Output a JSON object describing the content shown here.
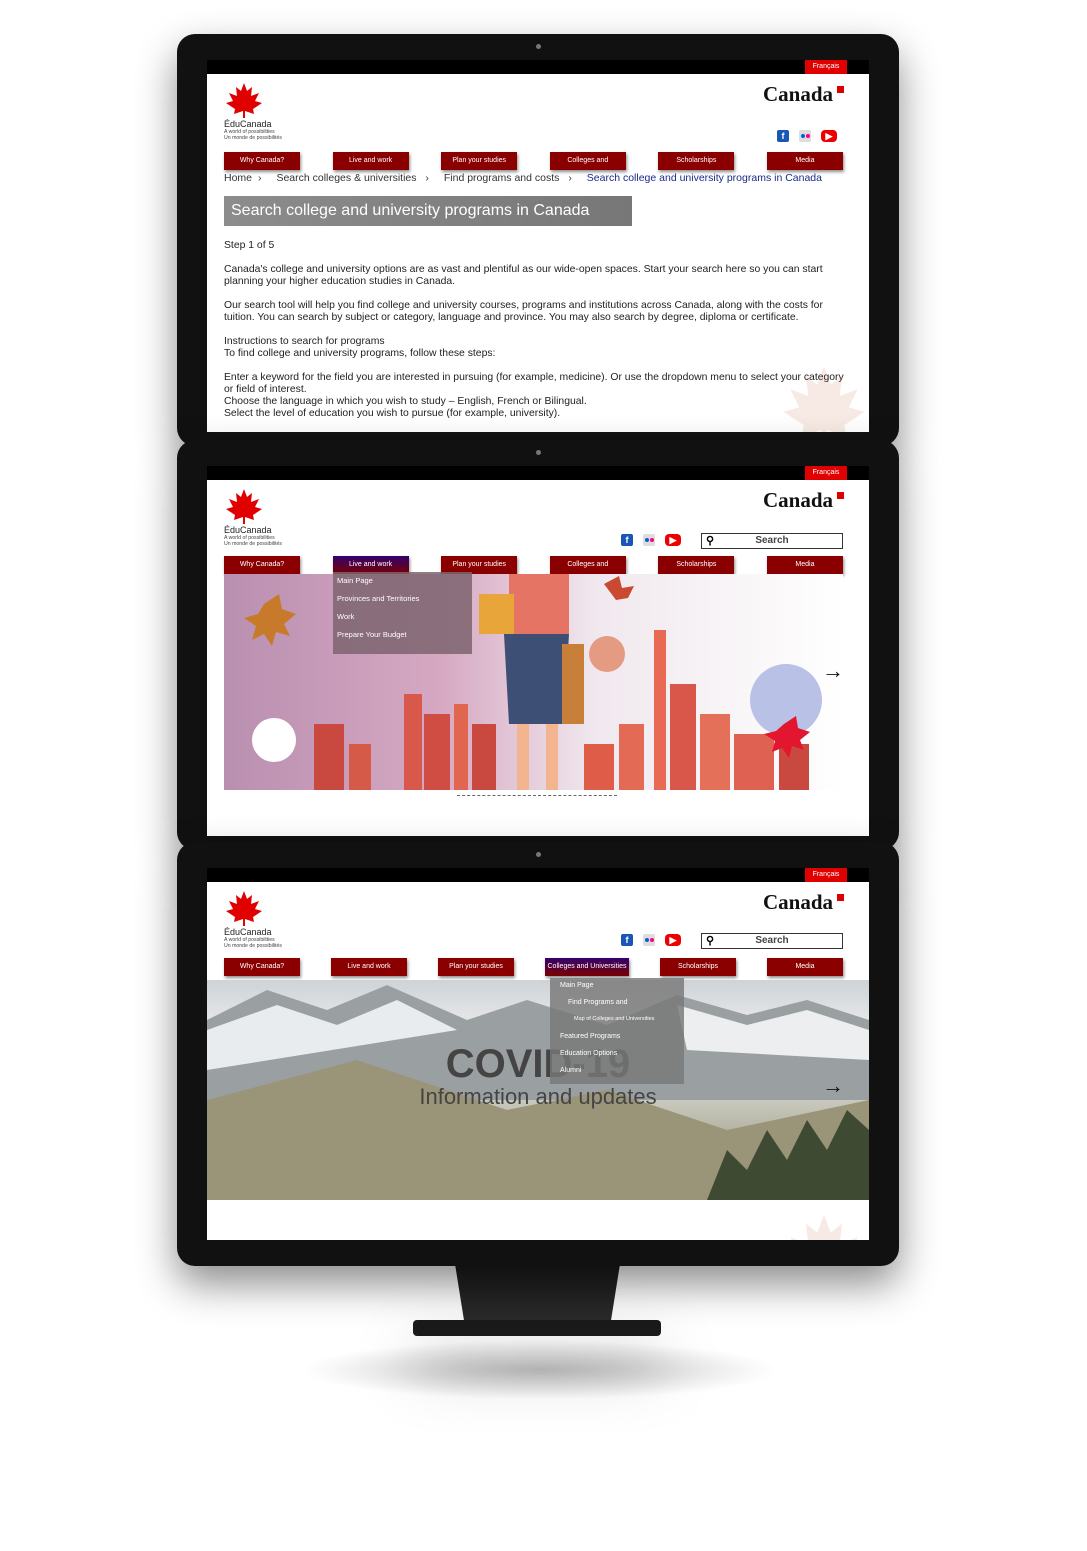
{
  "site": {
    "francais": "Français",
    "logo_name": "ÉduCanada",
    "logo_tag_en": "A world of possibilities",
    "logo_tag_fr": "Un monde de possibilités",
    "wordmark": "Canada",
    "search_label": "Search",
    "nav": [
      "Why Canada?",
      "Live and work",
      "Plan your studies",
      "Colleges and Universities",
      "Scholarships",
      "Media"
    ],
    "colors": {
      "nav": "#8a0000",
      "topbar": "#000000",
      "francais": "#e00000",
      "crumb_current": "#1a2a8a"
    }
  },
  "screen1": {
    "breadcrumbs": [
      "Home",
      "Search colleges & universities",
      "Find programs and costs",
      "Search college and university programs in Canada"
    ],
    "page_title": "Search college and university programs in Canada",
    "step": "Step 1 of 5",
    "para1": "Canada's college and university options are as vast and plentiful as our wide-open spaces. Start your search here so you can start planning your higher education studies in Canada.",
    "para2": "Our search tool will help you find college and university courses, programs and institutions across Canada, along with the costs for tuition. You can search by subject or category, language and province. You may also search by degree, diploma or certificate.",
    "instr_heading": "Instructions to search for programs",
    "instr_intro": "To find college and university programs, follow these steps:",
    "step_a": "Enter a keyword for the field you are interested in pursuing (for example, medicine). Or use the dropdown menu to select your category or field of interest.",
    "step_b": "Choose the language in which you wish to study – English, French or Bilingual.",
    "step_c": "Select the level of education you wish to pursue (for example, university)."
  },
  "screen2": {
    "dropdown": [
      "Main Page",
      "Provinces and Territories",
      "Work",
      "Prepare Your Budget"
    ],
    "next_arrow": "→"
  },
  "screen3": {
    "dropdown": [
      "Main Page",
      "Find Programs and",
      "Map of Colleges and Universities",
      "Featured Programs",
      "Education Options",
      "Alumni"
    ],
    "hero_title": "COVID-19",
    "hero_subtitle": "Information and updates",
    "next_arrow": "→"
  }
}
